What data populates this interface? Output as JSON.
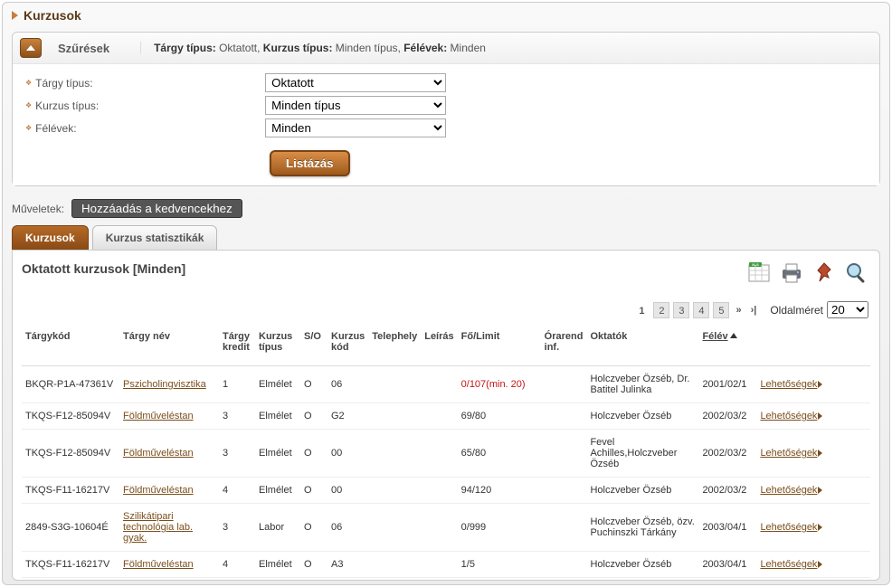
{
  "page": {
    "title": "Kurzusok"
  },
  "filters": {
    "title": "Szűrések",
    "summary_html": "<b>Tárgy típus:</b> Oktatott, <b>Kurzus típus:</b> Minden típus, <b>Félévek:</b> Minden",
    "rows": {
      "targy_tipus": {
        "label": "Tárgy típus:",
        "value": "Oktatott"
      },
      "kurzus_tipus": {
        "label": "Kurzus típus:",
        "value": "Minden típus"
      },
      "felevek": {
        "label": "Félévek:",
        "value": "Minden"
      }
    },
    "list_button": "Listázás"
  },
  "ops": {
    "label": "Műveletek:",
    "favorite": "Hozzáadás a kedvencekhez"
  },
  "tabs": {
    "courses": "Kurzusok",
    "stats": "Kurzus statisztikák"
  },
  "content": {
    "title": "Oktatott kurzusok [Minden]"
  },
  "pager": {
    "pages": [
      "1",
      "2",
      "3",
      "4",
      "5"
    ],
    "active": "1",
    "size_label": "Oldalméret",
    "size_value": "20"
  },
  "columns": {
    "targykod": "Tárgykód",
    "targynev": "Tárgy név",
    "kredit": "Tárgy kredit",
    "ktipus": "Kurzus típus",
    "so": "S/O",
    "kkod": "Kurzus kód",
    "telephely": "Telephely",
    "leiras": "Leírás",
    "folimit": "Fő/Limit",
    "orarend": "Órarend inf.",
    "oktatok": "Oktatók",
    "felev": "Félév",
    "opts": ""
  },
  "opts_label": "Lehetőségek",
  "rows": [
    {
      "kod": "BKQR-P1A-47361V",
      "nev": "Pszicholingvisztika",
      "kredit": "1",
      "ktipus": "Elmélet",
      "so": "O",
      "kkod": "06",
      "folimit": "0/107(min. 20)",
      "folimit_red": true,
      "oktatok": "Holczveber Özséb, Dr. Batitel Julinka",
      "felev": "2001/02/1"
    },
    {
      "kod": "TKQS-F12-85094V",
      "nev": "Földműveléstan",
      "kredit": "3",
      "ktipus": "Elmélet",
      "so": "O",
      "kkod": "G2",
      "folimit": "69/80",
      "folimit_red": false,
      "oktatok": "Holczveber Özséb",
      "felev": "2002/03/2"
    },
    {
      "kod": "TKQS-F12-85094V",
      "nev": "Földműveléstan",
      "kredit": "3",
      "ktipus": "Elmélet",
      "so": "O",
      "kkod": "00",
      "folimit": "65/80",
      "folimit_red": false,
      "oktatok": "Fevel Achilles,Holczveber Özséb",
      "felev": "2002/03/2"
    },
    {
      "kod": "TKQS-F11-16217V",
      "nev": "Földműveléstan",
      "kredit": "4",
      "ktipus": "Elmélet",
      "so": "O",
      "kkod": "00",
      "folimit": "94/120",
      "folimit_red": false,
      "oktatok": "Holczveber Özséb",
      "felev": "2002/03/2"
    },
    {
      "kod": "2849-S3G-10604É",
      "nev": "Szilikátipari technológia lab. gyak.",
      "kredit": "3",
      "ktipus": "Labor",
      "so": "O",
      "kkod": "06",
      "folimit": "0/999",
      "folimit_red": false,
      "oktatok": "Holczveber Özséb, özv. Puchinszki Tárkány",
      "felev": "2003/04/1"
    },
    {
      "kod": "TKQS-F11-16217V",
      "nev": "Földműveléstan",
      "kredit": "4",
      "ktipus": "Elmélet",
      "so": "O",
      "kkod": "A3",
      "folimit": "1/5",
      "folimit_red": false,
      "oktatok": "Holczveber Özséb",
      "felev": "2003/04/1"
    }
  ]
}
